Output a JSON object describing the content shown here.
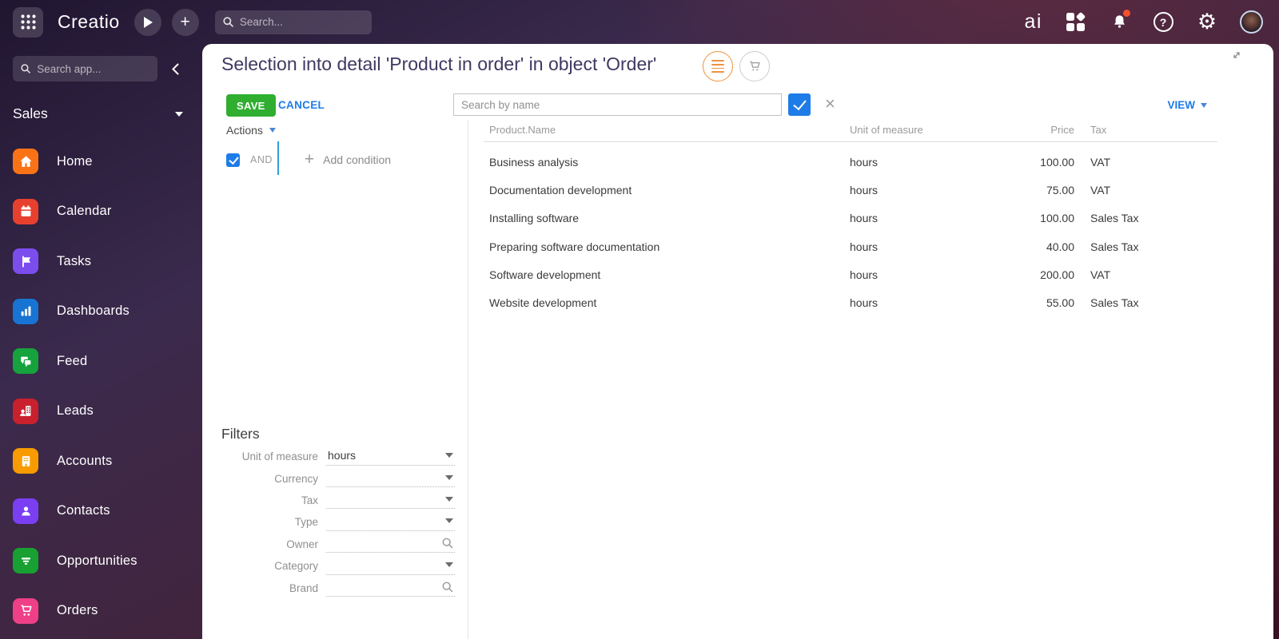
{
  "colors": {
    "save_green": "#2fae2f",
    "link_blue": "#1f7ce8",
    "accent_orange": "#f0923f",
    "title_navy": "#3e3960",
    "check_blue": "#1e7ce8",
    "cond_line_blue": "#2d9fe0",
    "notify_red": "#f4502c"
  },
  "topbar": {
    "logo": "Creatio",
    "search_placeholder": "Search...",
    "ai_label": "ai"
  },
  "sidebar": {
    "search_placeholder": "Search app...",
    "workspace": "Sales",
    "items": [
      {
        "label": "Home",
        "icon": "home-icon",
        "color": "#f97316"
      },
      {
        "label": "Calendar",
        "icon": "calendar-icon",
        "color": "#e8402e"
      },
      {
        "label": "Tasks",
        "icon": "flag-icon",
        "color": "#7c4ded"
      },
      {
        "label": "Dashboards",
        "icon": "bar-chart-icon",
        "color": "#1874d2"
      },
      {
        "label": "Feed",
        "icon": "chat-bubbles-icon",
        "color": "#16a23c"
      },
      {
        "label": "Leads",
        "icon": "lead-building-icon",
        "color": "#c9202e"
      },
      {
        "label": "Accounts",
        "icon": "building-icon",
        "color": "#f89b00"
      },
      {
        "label": "Contacts",
        "icon": "person-icon",
        "color": "#7a3ff2"
      },
      {
        "label": "Opportunities",
        "icon": "funnel-icon",
        "color": "#18a033"
      },
      {
        "label": "Orders",
        "icon": "cart-icon",
        "color": "#ee3f87"
      }
    ]
  },
  "main": {
    "title": "Selection into detail 'Product in order' in object 'Order'",
    "save_label": "SAVE",
    "cancel_label": "CANCEL",
    "actions_label": "Actions",
    "and_label": "AND",
    "add_condition_label": "Add condition",
    "search_placeholder": "Search by name",
    "view_label": "VIEW",
    "table": {
      "columns": {
        "name": "Product.Name",
        "unit": "Unit of measure",
        "price": "Price",
        "tax": "Tax"
      },
      "rows": [
        {
          "name": "Business analysis",
          "unit": "hours",
          "price": "100.00",
          "tax": "VAT"
        },
        {
          "name": "Documentation development",
          "unit": "hours",
          "price": "75.00",
          "tax": "VAT"
        },
        {
          "name": "Installing software",
          "unit": "hours",
          "price": "100.00",
          "tax": "Sales Tax"
        },
        {
          "name": "Preparing software documentation",
          "unit": "hours",
          "price": "40.00",
          "tax": "Sales Tax"
        },
        {
          "name": "Software development",
          "unit": "hours",
          "price": "200.00",
          "tax": "VAT"
        },
        {
          "name": "Website development",
          "unit": "hours",
          "price": "55.00",
          "tax": "Sales Tax"
        }
      ]
    },
    "filters": {
      "heading": "Filters",
      "rows": [
        {
          "label": "Unit of measure",
          "value": "hours",
          "control": "dropdown"
        },
        {
          "label": "Currency",
          "value": "",
          "control": "dropdown"
        },
        {
          "label": "Tax",
          "value": "",
          "control": "dropdown"
        },
        {
          "label": "Type",
          "value": "",
          "control": "dropdown"
        },
        {
          "label": "Owner",
          "value": "",
          "control": "lookup"
        },
        {
          "label": "Category",
          "value": "",
          "control": "dropdown"
        },
        {
          "label": "Brand",
          "value": "",
          "control": "lookup"
        }
      ]
    }
  }
}
